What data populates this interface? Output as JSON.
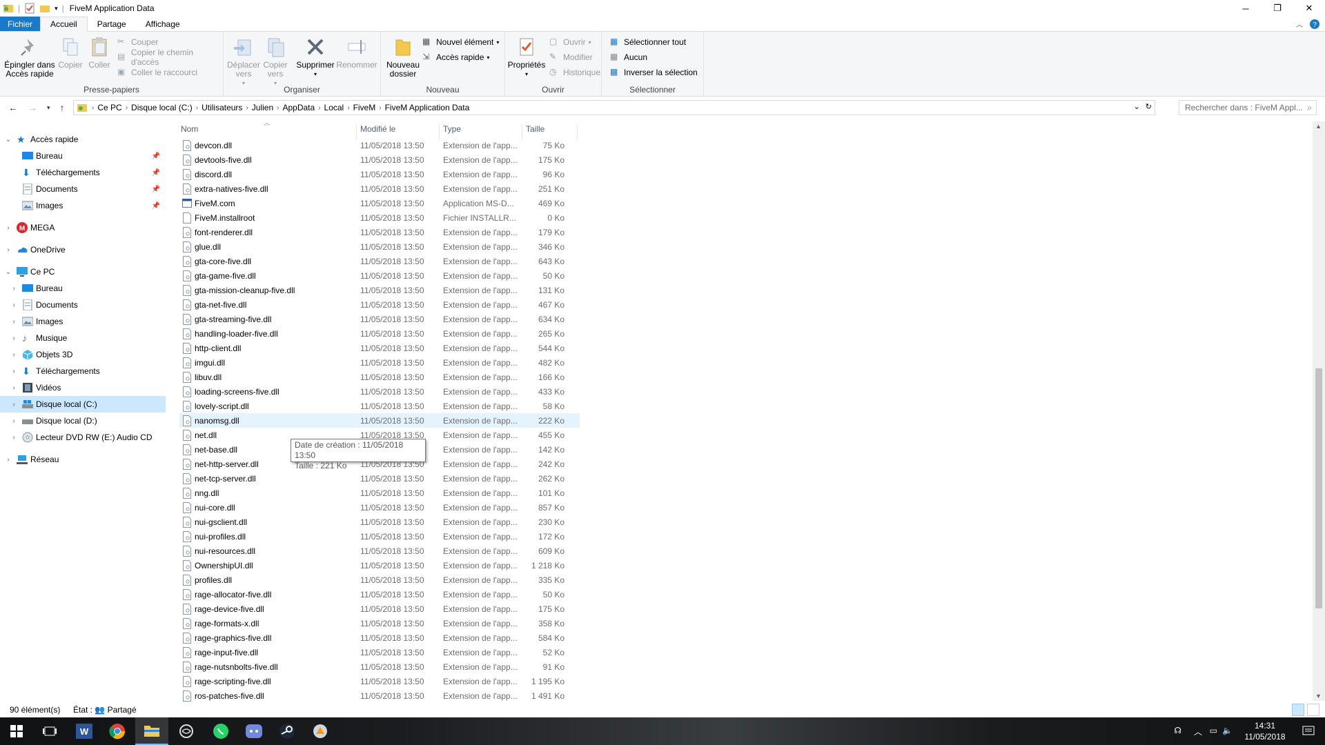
{
  "window": {
    "title": "FiveM Application Data",
    "controls": [
      "minimize",
      "restore",
      "close"
    ]
  },
  "ribbon_tabs": [
    {
      "label": "Fichier"
    },
    {
      "label": "Accueil"
    },
    {
      "label": "Partage"
    },
    {
      "label": "Affichage"
    }
  ],
  "ribbon": {
    "presse_papiers": {
      "label": "Presse-papiers",
      "pin": "Épingler dans Accès rapide",
      "copy": "Copier",
      "paste": "Coller",
      "cut": "Couper",
      "copy_path": "Copier le chemin d'accès",
      "paste_shortcut": "Coller le raccourci"
    },
    "organiser": {
      "label": "Organiser",
      "move_to": "Déplacer vers",
      "copy_to": "Copier vers",
      "delete": "Supprimer",
      "rename": "Renommer"
    },
    "nouveau": {
      "label": "Nouveau",
      "new_folder": "Nouveau dossier",
      "new_item": "Nouvel élément",
      "quick_access": "Accès rapide"
    },
    "ouvrir": {
      "label": "Ouvrir",
      "properties": "Propriétés",
      "open": "Ouvrir",
      "edit": "Modifier",
      "history": "Historique"
    },
    "selectionner": {
      "label": "Sélectionner",
      "select_all": "Sélectionner tout",
      "select_none": "Aucun",
      "invert": "Inverser la sélection"
    }
  },
  "address": {
    "crumbs": [
      "Ce PC",
      "Disque local (C:)",
      "Utilisateurs",
      "Julien",
      "AppData",
      "Local",
      "FiveM",
      "FiveM Application Data"
    ],
    "search_placeholder": "Rechercher dans : FiveM Appl..."
  },
  "nav": {
    "quick_access": "Accès rapide",
    "quick_items": [
      "Bureau",
      "Téléchargements",
      "Documents",
      "Images"
    ],
    "mega": "MEGA",
    "onedrive": "OneDrive",
    "this_pc": "Ce PC",
    "pc_items": [
      "Bureau",
      "Documents",
      "Images",
      "Musique",
      "Objets 3D",
      "Téléchargements",
      "Vidéos",
      "Disque local (C:)",
      "Disque local (D:)",
      "Lecteur DVD RW (E:) Audio CD"
    ],
    "network": "Réseau"
  },
  "columns": {
    "name": "Nom",
    "modified": "Modifié le",
    "type": "Type",
    "size": "Taille"
  },
  "files": [
    {
      "name": "devcon.dll",
      "date": "11/05/2018 13:50",
      "type": "Extension de l'app...",
      "size": "75 Ko"
    },
    {
      "name": "devtools-five.dll",
      "date": "11/05/2018 13:50",
      "type": "Extension de l'app...",
      "size": "175 Ko"
    },
    {
      "name": "discord.dll",
      "date": "11/05/2018 13:50",
      "type": "Extension de l'app...",
      "size": "96 Ko"
    },
    {
      "name": "extra-natives-five.dll",
      "date": "11/05/2018 13:50",
      "type": "Extension de l'app...",
      "size": "251 Ko"
    },
    {
      "name": "FiveM.com",
      "date": "11/05/2018 13:50",
      "type": "Application MS-D...",
      "size": "469 Ko"
    },
    {
      "name": "FiveM.installroot",
      "date": "11/05/2018 13:50",
      "type": "Fichier INSTALLR...",
      "size": "0 Ko"
    },
    {
      "name": "font-renderer.dll",
      "date": "11/05/2018 13:50",
      "type": "Extension de l'app...",
      "size": "179 Ko"
    },
    {
      "name": "glue.dll",
      "date": "11/05/2018 13:50",
      "type": "Extension de l'app...",
      "size": "346 Ko"
    },
    {
      "name": "gta-core-five.dll",
      "date": "11/05/2018 13:50",
      "type": "Extension de l'app...",
      "size": "643 Ko"
    },
    {
      "name": "gta-game-five.dll",
      "date": "11/05/2018 13:50",
      "type": "Extension de l'app...",
      "size": "50 Ko"
    },
    {
      "name": "gta-mission-cleanup-five.dll",
      "date": "11/05/2018 13:50",
      "type": "Extension de l'app...",
      "size": "131 Ko"
    },
    {
      "name": "gta-net-five.dll",
      "date": "11/05/2018 13:50",
      "type": "Extension de l'app...",
      "size": "467 Ko"
    },
    {
      "name": "gta-streaming-five.dll",
      "date": "11/05/2018 13:50",
      "type": "Extension de l'app...",
      "size": "634 Ko"
    },
    {
      "name": "handling-loader-five.dll",
      "date": "11/05/2018 13:50",
      "type": "Extension de l'app...",
      "size": "265 Ko"
    },
    {
      "name": "http-client.dll",
      "date": "11/05/2018 13:50",
      "type": "Extension de l'app...",
      "size": "544 Ko"
    },
    {
      "name": "imgui.dll",
      "date": "11/05/2018 13:50",
      "type": "Extension de l'app...",
      "size": "482 Ko"
    },
    {
      "name": "libuv.dll",
      "date": "11/05/2018 13:50",
      "type": "Extension de l'app...",
      "size": "166 Ko"
    },
    {
      "name": "loading-screens-five.dll",
      "date": "11/05/2018 13:50",
      "type": "Extension de l'app...",
      "size": "433 Ko"
    },
    {
      "name": "lovely-script.dll",
      "date": "11/05/2018 13:50",
      "type": "Extension de l'app...",
      "size": "58 Ko"
    },
    {
      "name": "nanomsg.dll",
      "date": "11/05/2018 13:50",
      "type": "Extension de l'app...",
      "size": "222 Ko",
      "hover": true
    },
    {
      "name": "net.dll",
      "date": "11/05/2018 13:50",
      "type": "Extension de l'app...",
      "size": "455 Ko"
    },
    {
      "name": "net-base.dll",
      "date": "11/05/2018 13:50",
      "type": "Extension de l'app...",
      "size": "142 Ko"
    },
    {
      "name": "net-http-server.dll",
      "date": "11/05/2018 13:50",
      "type": "Extension de l'app...",
      "size": "242 Ko"
    },
    {
      "name": "net-tcp-server.dll",
      "date": "11/05/2018 13:50",
      "type": "Extension de l'app...",
      "size": "262 Ko"
    },
    {
      "name": "nng.dll",
      "date": "11/05/2018 13:50",
      "type": "Extension de l'app...",
      "size": "101 Ko"
    },
    {
      "name": "nui-core.dll",
      "date": "11/05/2018 13:50",
      "type": "Extension de l'app...",
      "size": "857 Ko"
    },
    {
      "name": "nui-gsclient.dll",
      "date": "11/05/2018 13:50",
      "type": "Extension de l'app...",
      "size": "230 Ko"
    },
    {
      "name": "nui-profiles.dll",
      "date": "11/05/2018 13:50",
      "type": "Extension de l'app...",
      "size": "172 Ko"
    },
    {
      "name": "nui-resources.dll",
      "date": "11/05/2018 13:50",
      "type": "Extension de l'app...",
      "size": "609 Ko"
    },
    {
      "name": "OwnershipUI.dll",
      "date": "11/05/2018 13:50",
      "type": "Extension de l'app...",
      "size": "1 218 Ko"
    },
    {
      "name": "profiles.dll",
      "date": "11/05/2018 13:50",
      "type": "Extension de l'app...",
      "size": "335 Ko"
    },
    {
      "name": "rage-allocator-five.dll",
      "date": "11/05/2018 13:50",
      "type": "Extension de l'app...",
      "size": "50 Ko"
    },
    {
      "name": "rage-device-five.dll",
      "date": "11/05/2018 13:50",
      "type": "Extension de l'app...",
      "size": "175 Ko"
    },
    {
      "name": "rage-formats-x.dll",
      "date": "11/05/2018 13:50",
      "type": "Extension de l'app...",
      "size": "358 Ko"
    },
    {
      "name": "rage-graphics-five.dll",
      "date": "11/05/2018 13:50",
      "type": "Extension de l'app...",
      "size": "584 Ko"
    },
    {
      "name": "rage-input-five.dll",
      "date": "11/05/2018 13:50",
      "type": "Extension de l'app...",
      "size": "52 Ko"
    },
    {
      "name": "rage-nutsnbolts-five.dll",
      "date": "11/05/2018 13:50",
      "type": "Extension de l'app...",
      "size": "91 Ko"
    },
    {
      "name": "rage-scripting-five.dll",
      "date": "11/05/2018 13:50",
      "type": "Extension de l'app...",
      "size": "1 195 Ko"
    },
    {
      "name": "ros-patches-five.dll",
      "date": "11/05/2018 13:50",
      "type": "Extension de l'app...",
      "size": "1 491 Ko"
    }
  ],
  "tooltip": {
    "line1": "Date de création : 11/05/2018 13:50",
    "line2": "Taille : 221 Ko"
  },
  "status": {
    "count": "90 élément(s)",
    "state": "État : 👥 Partagé"
  },
  "taskbar": {
    "time": "14:31",
    "date": "11/05/2018",
    "apps": [
      "start",
      "task-view",
      "word",
      "chrome",
      "file-explorer",
      "app-circle",
      "whatsapp",
      "discord",
      "steam",
      "app-other"
    ]
  },
  "colors": {
    "file_tab": "#1979ca",
    "selection": "#cce8ff",
    "hover": "#e5f3ff"
  }
}
